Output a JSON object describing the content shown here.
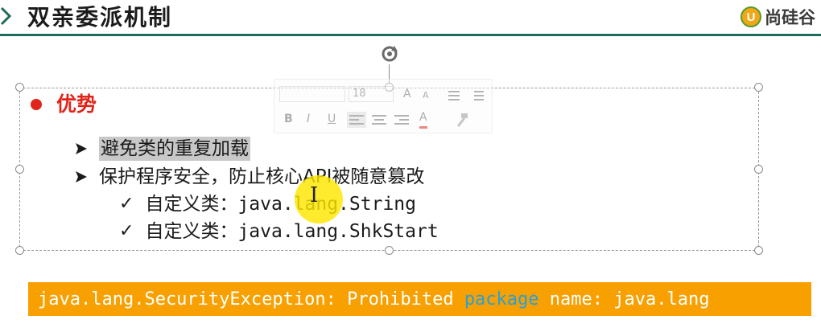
{
  "header": {
    "title": "双亲委派机制",
    "logo_letter": "U",
    "logo_text": "尚硅谷"
  },
  "toolbar": {
    "font_size": "18",
    "grow_font": "A",
    "shrink_font": "A",
    "bold": "B",
    "italic": "I",
    "underline": "U",
    "font_color": "A"
  },
  "content": {
    "heading": "优势",
    "items": [
      {
        "text": "避免类的重复加载"
      },
      {
        "text": "保护程序安全，防止核心API被随意篡改"
      }
    ],
    "subitems": [
      {
        "label": "自定义类：",
        "code": "java.lang.String"
      },
      {
        "label": "自定义类：",
        "code": "java.lang.ShkStart"
      }
    ]
  },
  "banner": {
    "before": "java.lang.SecurityException: Prohibited ",
    "keyword": "package",
    "after": " name: java.lang"
  },
  "colors": {
    "accent_red": "#e0261c",
    "header_line": "#1f6b5c",
    "banner_bg": "#f8a000",
    "keyword_blue": "#2aa0d8"
  }
}
